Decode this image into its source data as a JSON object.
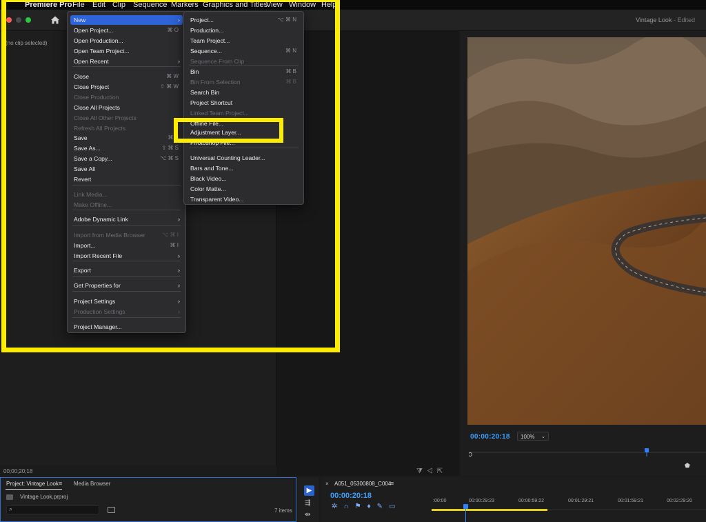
{
  "menubar": {
    "apple": "",
    "app_name": "Premiere Pro",
    "items": [
      "File",
      "Edit",
      "Clip",
      "Sequence",
      "Markers",
      "Graphics and Titles",
      "View",
      "Window",
      "Help"
    ]
  },
  "window": {
    "title": "Vintage Look",
    "status": "- Edited"
  },
  "source_monitor": {
    "no_clip": "(no clip selected)",
    "timecode": "00;00;20;18"
  },
  "program_monitor": {
    "timecode": "00:00:20:18",
    "zoom": "100%"
  },
  "project_panel": {
    "tab_project": "Project: Vintage Look",
    "tab_media_browser": "Media Browser",
    "file_name": "Vintage Look.prproj",
    "search_placeholder": "",
    "items_count": "7 items"
  },
  "timeline": {
    "sequence_name": "A051_05300808_C004",
    "timecode": "00:00:20:18",
    "ticks": [
      ":00:00",
      "00:00:29:23",
      "00:00:59:22",
      "00:01:29:21",
      "00:01:59:21",
      "00:02:29:20"
    ]
  },
  "file_menu": {
    "items": [
      {
        "label": "New",
        "shortcut": "",
        "submenu": true,
        "disabled": false,
        "highlighted": true
      },
      {
        "label": "Open Project...",
        "shortcut": "⌘ O",
        "submenu": false,
        "disabled": false
      },
      {
        "label": "Open Production...",
        "shortcut": "",
        "submenu": false,
        "disabled": false
      },
      {
        "label": "Open Team Project...",
        "shortcut": "",
        "submenu": false,
        "disabled": false
      },
      {
        "label": "Open Recent",
        "shortcut": "",
        "submenu": true,
        "disabled": false
      },
      {
        "label": "Close",
        "shortcut": "⌘ W",
        "submenu": false,
        "disabled": false
      },
      {
        "label": "Close Project",
        "shortcut": "⇧ ⌘ W",
        "submenu": false,
        "disabled": false
      },
      {
        "label": "Close Production",
        "shortcut": "",
        "submenu": false,
        "disabled": true
      },
      {
        "label": "Close All Projects",
        "shortcut": "",
        "submenu": false,
        "disabled": false
      },
      {
        "label": "Close All Other Projects",
        "shortcut": "",
        "submenu": false,
        "disabled": true
      },
      {
        "label": "Refresh All Projects",
        "shortcut": "",
        "submenu": false,
        "disabled": true
      },
      {
        "label": "Save",
        "shortcut": "⌘ S",
        "submenu": false,
        "disabled": false
      },
      {
        "label": "Save As...",
        "shortcut": "⇧ ⌘ S",
        "submenu": false,
        "disabled": false
      },
      {
        "label": "Save a Copy...",
        "shortcut": "⌥ ⌘ S",
        "submenu": false,
        "disabled": false
      },
      {
        "label": "Save All",
        "shortcut": "",
        "submenu": false,
        "disabled": false
      },
      {
        "label": "Revert",
        "shortcut": "",
        "submenu": false,
        "disabled": false
      },
      {
        "label": "Link Media...",
        "shortcut": "",
        "submenu": false,
        "disabled": true
      },
      {
        "label": "Make Offline...",
        "shortcut": "",
        "submenu": false,
        "disabled": true
      },
      {
        "label": "Adobe Dynamic Link",
        "shortcut": "",
        "submenu": true,
        "disabled": false
      },
      {
        "label": "Import from Media Browser",
        "shortcut": "⌥ ⌘ I",
        "submenu": false,
        "disabled": true
      },
      {
        "label": "Import...",
        "shortcut": "⌘ I",
        "submenu": false,
        "disabled": false
      },
      {
        "label": "Import Recent File",
        "shortcut": "",
        "submenu": true,
        "disabled": false
      },
      {
        "label": "Export",
        "shortcut": "",
        "submenu": true,
        "disabled": false
      },
      {
        "label": "Get Properties for",
        "shortcut": "",
        "submenu": true,
        "disabled": false
      },
      {
        "label": "Project Settings",
        "shortcut": "",
        "submenu": true,
        "disabled": false
      },
      {
        "label": "Production Settings",
        "shortcut": "",
        "submenu": true,
        "disabled": true
      },
      {
        "label": "Project Manager...",
        "shortcut": "",
        "submenu": false,
        "disabled": false
      }
    ]
  },
  "new_menu": {
    "items": [
      {
        "label": "Project...",
        "shortcut": "⌥ ⌘ N",
        "disabled": false
      },
      {
        "label": "Production...",
        "shortcut": "",
        "disabled": false
      },
      {
        "label": "Team Project...",
        "shortcut": "",
        "disabled": false
      },
      {
        "label": "Sequence...",
        "shortcut": "⌘ N",
        "disabled": false
      },
      {
        "label": "Sequence From Clip",
        "shortcut": "",
        "disabled": true
      },
      {
        "label": "Bin",
        "shortcut": "⌘ B",
        "disabled": false
      },
      {
        "label": "Bin From Selection",
        "shortcut": "⌘ B",
        "disabled": true
      },
      {
        "label": "Search Bin",
        "shortcut": "",
        "disabled": false
      },
      {
        "label": "Project Shortcut",
        "shortcut": "",
        "disabled": false
      },
      {
        "label": "Linked Team Project...",
        "shortcut": "",
        "disabled": true
      },
      {
        "label": "Offline File...",
        "shortcut": "",
        "disabled": false
      },
      {
        "label": "Adjustment Layer...",
        "shortcut": "",
        "disabled": false
      },
      {
        "label": "Photoshop File...",
        "shortcut": "",
        "disabled": false
      },
      {
        "label": "Universal Counting Leader...",
        "shortcut": "",
        "disabled": false
      },
      {
        "label": "Bars and Tone...",
        "shortcut": "",
        "disabled": false
      },
      {
        "label": "Black Video...",
        "shortcut": "",
        "disabled": false
      },
      {
        "label": "Color Matte...",
        "shortcut": "",
        "disabled": false
      },
      {
        "label": "Transparent Video...",
        "shortcut": "",
        "disabled": false
      }
    ]
  },
  "colors": {
    "annotation": "#fcec00",
    "accent": "#2d64d9",
    "timecode": "#3aa0ff"
  }
}
